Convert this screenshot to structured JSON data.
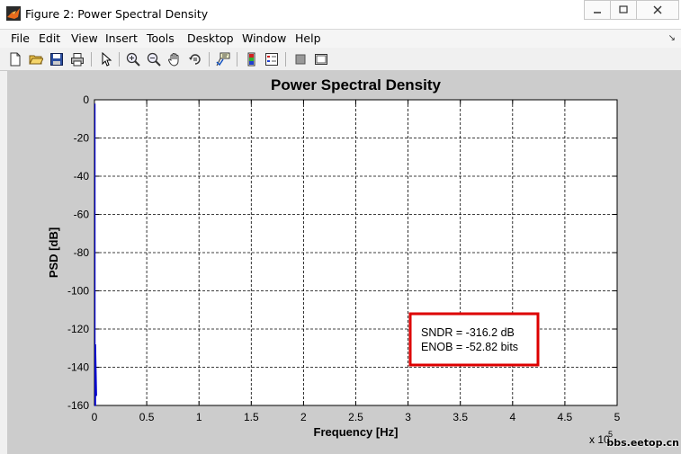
{
  "window": {
    "title": "Figure 2: Power Spectral Density",
    "controls": [
      "minimize-icon",
      "maximize-icon",
      "close-icon"
    ]
  },
  "menu": {
    "items": [
      "File",
      "Edit",
      "View",
      "Insert",
      "Tools",
      "Desktop",
      "Window",
      "Help"
    ]
  },
  "toolbar": {
    "icons": [
      "new-figure-icon",
      "open-file-icon",
      "save-icon",
      "print-icon",
      "pointer-icon",
      "zoom-in-icon",
      "zoom-out-icon",
      "pan-icon",
      "rotate-icon",
      "data-cursor-icon",
      "colorbar-icon",
      "legend-icon",
      "hide-plot-tools-icon",
      "show-plot-tools-icon"
    ]
  },
  "chart_data": {
    "type": "line",
    "title": "Power Spectral Density",
    "xlabel": "Frequency [Hz]",
    "ylabel": "PSD [dB]",
    "xlim": [
      0,
      5
    ],
    "ylim": [
      -160,
      0
    ],
    "x_multiplier": "x 10",
    "x_multiplier_exponent": "5",
    "xticks": [
      "0",
      "0.5",
      "1",
      "1.5",
      "2",
      "2.5",
      "3",
      "3.5",
      "4",
      "4.5",
      "5"
    ],
    "yticks": [
      "0",
      "-20",
      "-40",
      "-60",
      "-80",
      "-100",
      "-120",
      "-140",
      "-160"
    ],
    "grid": true,
    "series_color": "#0000cc",
    "series": [
      {
        "x": [
          0.005,
          0.005,
          0.01,
          0.01,
          0.015,
          0.02
        ],
        "y": [
          -2,
          -160,
          -160,
          -128,
          -140,
          -155
        ]
      }
    ],
    "annotation": {
      "lines": [
        "SNDR = -316.2 dB",
        "ENOB = -52.82 bits"
      ],
      "border_color": "#dd0000"
    }
  },
  "watermark": "bbs.eetop.cn"
}
